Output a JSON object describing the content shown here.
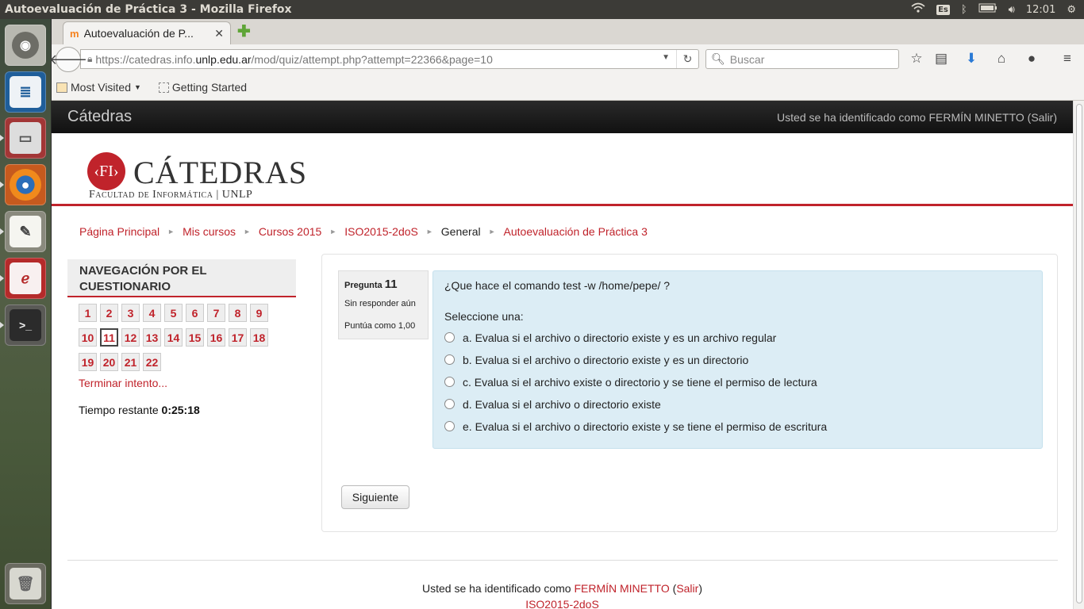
{
  "os": {
    "window_title": "Autoevaluación de Práctica 3 - Mozilla Firefox",
    "keyboard_layout": "Es",
    "clock": "12:01",
    "tray_icons": [
      "wifi-icon",
      "keyboard-icon",
      "bluetooth-icon",
      "battery-icon",
      "volume-icon",
      "gear-icon"
    ]
  },
  "launcher": {
    "items": [
      "ubuntu-dash-icon",
      "libreoffice-writer-icon",
      "file-manager-icon",
      "firefox-icon",
      "text-editor-icon",
      "pdf-viewer-icon",
      "terminal-icon",
      "trash-icon"
    ]
  },
  "browser": {
    "tab_title": "Autoevaluación de P...",
    "url_prefix": "https://catedras.info.",
    "url_host": "unlp.edu.ar",
    "url_path": "/mod/quiz/attempt.php?attempt=22366&page=10",
    "search_placeholder": "Buscar",
    "bookmarks": [
      "Most Visited",
      "Getting Started"
    ]
  },
  "site": {
    "brand": "Cátedras",
    "login_text": "Usted se ha identificado como FERMÍN MINETTO (Salir)",
    "logo_mark": "‹FI›",
    "logo_title": "CÁTEDRAS",
    "logo_subtitle": "Facultad de Informática | UNLP"
  },
  "breadcrumb": [
    "Página Principal",
    "Mis cursos",
    "Cursos 2015",
    "ISO2015-2doS",
    "General",
    "Autoevaluación de Práctica 3"
  ],
  "quiz_nav": {
    "heading": "NAVEGACIÓN POR EL CUESTIONARIO",
    "questions": [
      "1",
      "2",
      "3",
      "4",
      "5",
      "6",
      "7",
      "8",
      "9",
      "10",
      "11",
      "12",
      "13",
      "14",
      "15",
      "16",
      "17",
      "18",
      "19",
      "20",
      "21",
      "22"
    ],
    "current": "11",
    "finish_link": "Terminar intento...",
    "time_label": "Tiempo restante",
    "time_value": "0:25:18"
  },
  "question": {
    "label": "Pregunta",
    "number": "11",
    "state": "Sin responder aún",
    "marks": "Puntúa como 1,00",
    "text": "¿Que hace el comando test -w /home/pepe/ ?",
    "prompt": "Seleccione una:",
    "options": [
      "a. Evalua si el archivo o directorio existe y es un archivo regular",
      "b. Evalua si el archivo o directorio existe y es un directorio",
      "c. Evalua si el archivo existe o directorio y se tiene el permiso de lectura",
      "d. Evalua si el archivo o directorio existe",
      "e. Evalua si el archivo o directorio existe y se tiene el permiso de escritura"
    ],
    "next_button": "Siguiente"
  },
  "footer": {
    "login_prefix": "Usted se ha identificado como",
    "user": "FERMÍN MINETTO",
    "logout": "Salir",
    "course": "ISO2015-2doS"
  },
  "colors": {
    "accent": "#c0232b",
    "question_bg": "#dcedf5",
    "header_bg": "#1a1a1a"
  }
}
